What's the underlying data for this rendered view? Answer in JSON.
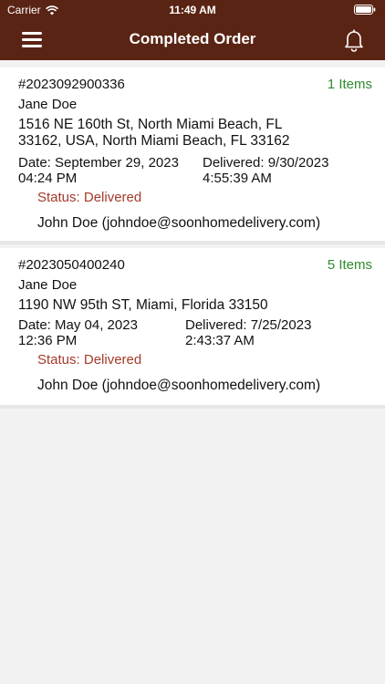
{
  "status_bar": {
    "carrier": "Carrier",
    "time": "11:49 AM"
  },
  "nav": {
    "title": "Completed Order",
    "menu_icon": "hamburger-menu-icon",
    "notification_icon": "bell-icon"
  },
  "colors": {
    "header": "#5a2414",
    "items_count": "#2f8a2f",
    "status": "#a33a2a",
    "background": "#f2f2f2"
  },
  "orders": [
    {
      "number": "#2023092900336",
      "items": "1 Items",
      "customer": "Jane Doe",
      "address_line1": "1516 NE 160th St, North Miami Beach, FL",
      "address_line2": "33162, USA, North Miami Beach, FL 33162",
      "date_line1": "Date: September 29, 2023",
      "date_line2": "04:24 PM",
      "delivered_line1": "Delivered: 9/30/2023",
      "delivered_line2": "4:55:39 AM",
      "status": "Status: Delivered",
      "driver": "John Doe (johndoe@soonhomedelivery.com)"
    },
    {
      "number": "#2023050400240",
      "items": "5 Items",
      "customer": "Jane Doe",
      "address_line1": "1190 NW 95th ST, Miami, Florida 33150",
      "date_line1": "Date: May 04, 2023",
      "date_line2": "12:36 PM",
      "delivered_line1": "Delivered: 7/25/2023",
      "delivered_line2": "2:43:37 AM",
      "status": "Status: Delivered",
      "driver": "John Doe (johndoe@soonhomedelivery.com)"
    }
  ]
}
